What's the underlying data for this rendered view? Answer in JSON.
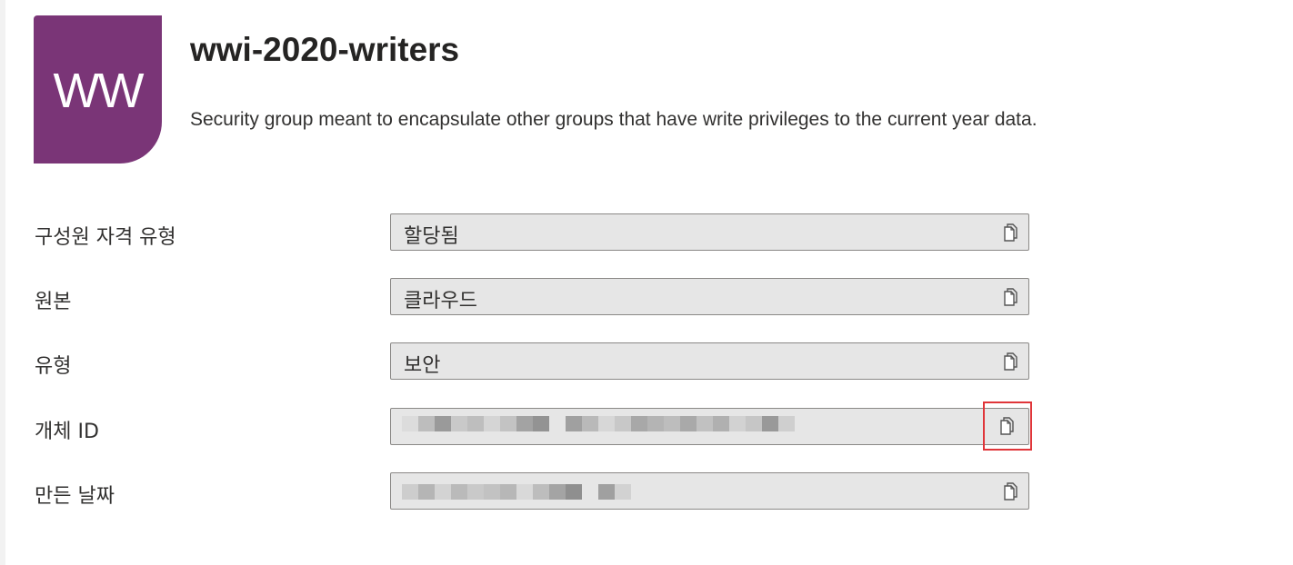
{
  "group": {
    "initials": "WW",
    "avatar_color": "#7a3577",
    "name": "wwi-2020-writers",
    "description": "Security group meant to encapsulate other groups that have write privileges to the current year data."
  },
  "fields": [
    {
      "label": "구성원 자격 유형",
      "value": "할당됨",
      "redacted": false
    },
    {
      "label": "원본",
      "value": "클라우드",
      "redacted": false
    },
    {
      "label": "유형",
      "value": "보안",
      "redacted": false
    },
    {
      "label": "개체 ID",
      "value": "",
      "redacted": true
    },
    {
      "label": "만든 날짜",
      "value": "",
      "redacted": true
    }
  ],
  "icons": {
    "copy": "copy-icon"
  },
  "highlight_color": "#e0363a"
}
